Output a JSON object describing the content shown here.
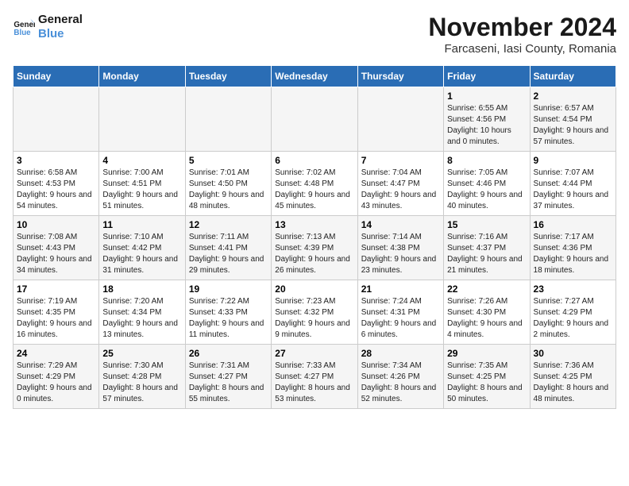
{
  "header": {
    "logo_line1": "General",
    "logo_line2": "Blue",
    "month_title": "November 2024",
    "location": "Farcaseni, Iasi County, Romania"
  },
  "days_of_week": [
    "Sunday",
    "Monday",
    "Tuesday",
    "Wednesday",
    "Thursday",
    "Friday",
    "Saturday"
  ],
  "weeks": [
    [
      {
        "day": "",
        "info": ""
      },
      {
        "day": "",
        "info": ""
      },
      {
        "day": "",
        "info": ""
      },
      {
        "day": "",
        "info": ""
      },
      {
        "day": "",
        "info": ""
      },
      {
        "day": "1",
        "info": "Sunrise: 6:55 AM\nSunset: 4:56 PM\nDaylight: 10 hours and 0 minutes."
      },
      {
        "day": "2",
        "info": "Sunrise: 6:57 AM\nSunset: 4:54 PM\nDaylight: 9 hours and 57 minutes."
      }
    ],
    [
      {
        "day": "3",
        "info": "Sunrise: 6:58 AM\nSunset: 4:53 PM\nDaylight: 9 hours and 54 minutes."
      },
      {
        "day": "4",
        "info": "Sunrise: 7:00 AM\nSunset: 4:51 PM\nDaylight: 9 hours and 51 minutes."
      },
      {
        "day": "5",
        "info": "Sunrise: 7:01 AM\nSunset: 4:50 PM\nDaylight: 9 hours and 48 minutes."
      },
      {
        "day": "6",
        "info": "Sunrise: 7:02 AM\nSunset: 4:48 PM\nDaylight: 9 hours and 45 minutes."
      },
      {
        "day": "7",
        "info": "Sunrise: 7:04 AM\nSunset: 4:47 PM\nDaylight: 9 hours and 43 minutes."
      },
      {
        "day": "8",
        "info": "Sunrise: 7:05 AM\nSunset: 4:46 PM\nDaylight: 9 hours and 40 minutes."
      },
      {
        "day": "9",
        "info": "Sunrise: 7:07 AM\nSunset: 4:44 PM\nDaylight: 9 hours and 37 minutes."
      }
    ],
    [
      {
        "day": "10",
        "info": "Sunrise: 7:08 AM\nSunset: 4:43 PM\nDaylight: 9 hours and 34 minutes."
      },
      {
        "day": "11",
        "info": "Sunrise: 7:10 AM\nSunset: 4:42 PM\nDaylight: 9 hours and 31 minutes."
      },
      {
        "day": "12",
        "info": "Sunrise: 7:11 AM\nSunset: 4:41 PM\nDaylight: 9 hours and 29 minutes."
      },
      {
        "day": "13",
        "info": "Sunrise: 7:13 AM\nSunset: 4:39 PM\nDaylight: 9 hours and 26 minutes."
      },
      {
        "day": "14",
        "info": "Sunrise: 7:14 AM\nSunset: 4:38 PM\nDaylight: 9 hours and 23 minutes."
      },
      {
        "day": "15",
        "info": "Sunrise: 7:16 AM\nSunset: 4:37 PM\nDaylight: 9 hours and 21 minutes."
      },
      {
        "day": "16",
        "info": "Sunrise: 7:17 AM\nSunset: 4:36 PM\nDaylight: 9 hours and 18 minutes."
      }
    ],
    [
      {
        "day": "17",
        "info": "Sunrise: 7:19 AM\nSunset: 4:35 PM\nDaylight: 9 hours and 16 minutes."
      },
      {
        "day": "18",
        "info": "Sunrise: 7:20 AM\nSunset: 4:34 PM\nDaylight: 9 hours and 13 minutes."
      },
      {
        "day": "19",
        "info": "Sunrise: 7:22 AM\nSunset: 4:33 PM\nDaylight: 9 hours and 11 minutes."
      },
      {
        "day": "20",
        "info": "Sunrise: 7:23 AM\nSunset: 4:32 PM\nDaylight: 9 hours and 9 minutes."
      },
      {
        "day": "21",
        "info": "Sunrise: 7:24 AM\nSunset: 4:31 PM\nDaylight: 9 hours and 6 minutes."
      },
      {
        "day": "22",
        "info": "Sunrise: 7:26 AM\nSunset: 4:30 PM\nDaylight: 9 hours and 4 minutes."
      },
      {
        "day": "23",
        "info": "Sunrise: 7:27 AM\nSunset: 4:29 PM\nDaylight: 9 hours and 2 minutes."
      }
    ],
    [
      {
        "day": "24",
        "info": "Sunrise: 7:29 AM\nSunset: 4:29 PM\nDaylight: 9 hours and 0 minutes."
      },
      {
        "day": "25",
        "info": "Sunrise: 7:30 AM\nSunset: 4:28 PM\nDaylight: 8 hours and 57 minutes."
      },
      {
        "day": "26",
        "info": "Sunrise: 7:31 AM\nSunset: 4:27 PM\nDaylight: 8 hours and 55 minutes."
      },
      {
        "day": "27",
        "info": "Sunrise: 7:33 AM\nSunset: 4:27 PM\nDaylight: 8 hours and 53 minutes."
      },
      {
        "day": "28",
        "info": "Sunrise: 7:34 AM\nSunset: 4:26 PM\nDaylight: 8 hours and 52 minutes."
      },
      {
        "day": "29",
        "info": "Sunrise: 7:35 AM\nSunset: 4:25 PM\nDaylight: 8 hours and 50 minutes."
      },
      {
        "day": "30",
        "info": "Sunrise: 7:36 AM\nSunset: 4:25 PM\nDaylight: 8 hours and 48 minutes."
      }
    ]
  ]
}
